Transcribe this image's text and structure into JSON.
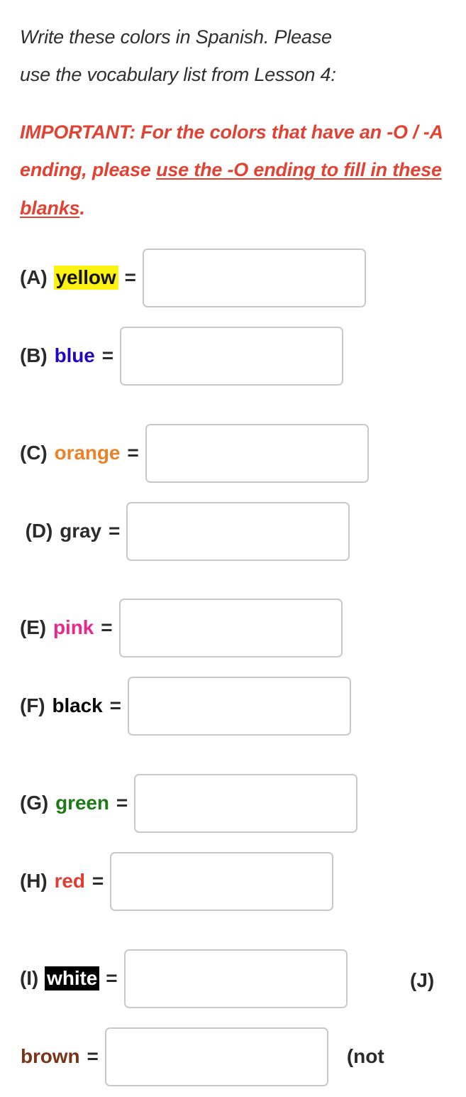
{
  "worksheet": {
    "instructions_line1": "Write these colors in Spanish. Please",
    "instructions_line2": "use the vocabulary list from Lesson 4:",
    "important_part1": "IMPORTANT: For the colors that have",
    "important_part2": "an -O / -A ending, please ",
    "important_underlined": "use the -O ending to fill in these blanks",
    "important_period": ".",
    "items": [
      {
        "marker": "(A)",
        "word": "yellow",
        "equals": "=",
        "value": "",
        "placeholder": "",
        "color": "#141414",
        "highlight": "#fcf313",
        "trailing": ""
      },
      {
        "marker": "(B)",
        "word": "blue",
        "equals": "=",
        "value": "",
        "placeholder": "",
        "color": "#2008c0",
        "highlight": "",
        "trailing": ""
      },
      {
        "marker": "(C)",
        "word": "orange",
        "equals": "=",
        "value": "",
        "placeholder": "",
        "color": "#e8832a",
        "highlight": "",
        "trailing": ""
      },
      {
        "marker": " (D)",
        "word": "gray",
        "equals": "=",
        "value": "",
        "placeholder": "",
        "color": "#2b2b2b",
        "highlight": "",
        "trailing": ""
      },
      {
        "marker": "(E)",
        "word": "pink",
        "equals": "=",
        "value": "",
        "placeholder": "",
        "color": "#ec268f",
        "highlight": "",
        "trailing": ""
      },
      {
        "marker": "(F)",
        "word": "black",
        "equals": "=",
        "value": "",
        "placeholder": "",
        "color": "#080808",
        "highlight": "",
        "trailing": ""
      },
      {
        "marker": "(G)",
        "word": "green",
        "equals": "=",
        "value": "",
        "placeholder": "",
        "color": "#1e7a18",
        "highlight": "",
        "trailing": ""
      },
      {
        "marker": "(H)",
        "word": "red",
        "equals": "=",
        "value": "",
        "placeholder": "",
        "color": "#e03c31",
        "highlight": "",
        "trailing": ""
      },
      {
        "marker": "(I)",
        "word": "white",
        "equals": "=",
        "value": "",
        "placeholder": "",
        "color": "#ffffff",
        "highlight": "#000000",
        "trailing": "(J)"
      },
      {
        "marker": "",
        "word": "brown",
        "equals": "=",
        "value": "",
        "placeholder": "",
        "color": "#7a3418",
        "highlight": "",
        "trailing": "(not"
      }
    ]
  }
}
